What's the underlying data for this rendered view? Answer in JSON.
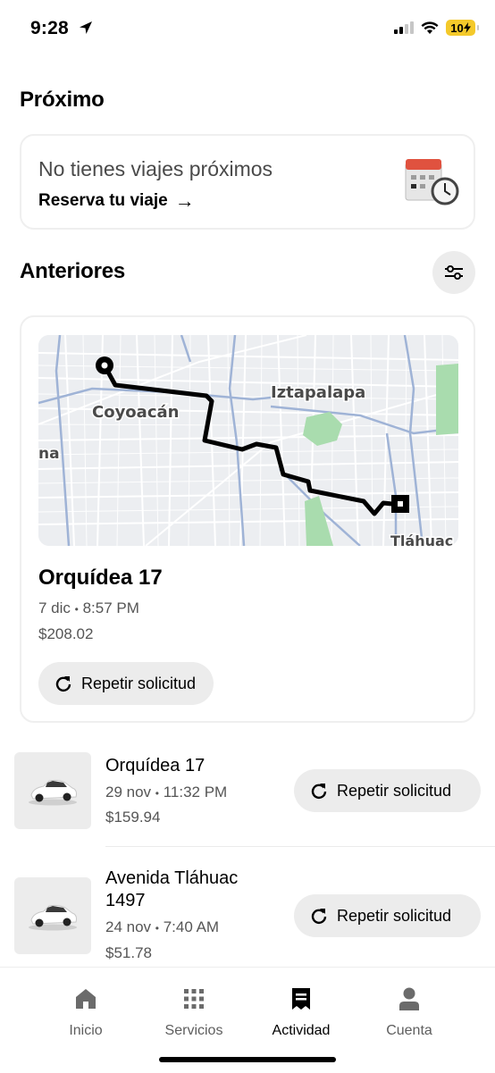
{
  "status_bar": {
    "time": "9:28",
    "battery": "10"
  },
  "upcoming": {
    "title": "Próximo",
    "empty_text": "No tienes viajes próximos",
    "link_label": "Reserva tu viaje",
    "link_arrow": "→"
  },
  "past": {
    "title": "Anteriores",
    "featured": {
      "map_labels": [
        "Coyoacán",
        "Iztapalapa",
        "na",
        "Tláhuac"
      ],
      "destination": "Orquídea 17",
      "date": "7 dic",
      "time": "8:57 PM",
      "price": "$208.02",
      "repeat_label": "Repetir solicitud"
    },
    "trips": [
      {
        "destination": "Orquídea 17",
        "date": "29 nov",
        "time": "11:32 PM",
        "price": "$159.94",
        "repeat_label": "Repetir solicitud"
      },
      {
        "destination": "Avenida Tláhuac 1497",
        "date": "24 nov",
        "time": "7:40 AM",
        "price": "$51.78",
        "repeat_label": "Repetir solicitud"
      }
    ],
    "meta_separator": "•"
  },
  "nav": {
    "items": [
      {
        "label": "Inicio",
        "icon": "home-icon"
      },
      {
        "label": "Servicios",
        "icon": "grid-icon"
      },
      {
        "label": "Actividad",
        "icon": "receipt-icon",
        "active": true
      },
      {
        "label": "Cuenta",
        "icon": "person-icon"
      }
    ]
  },
  "colors": {
    "accent": "#000000",
    "battery": "#f4c92a",
    "chip": "#ececec",
    "park": "#a9dcae"
  }
}
